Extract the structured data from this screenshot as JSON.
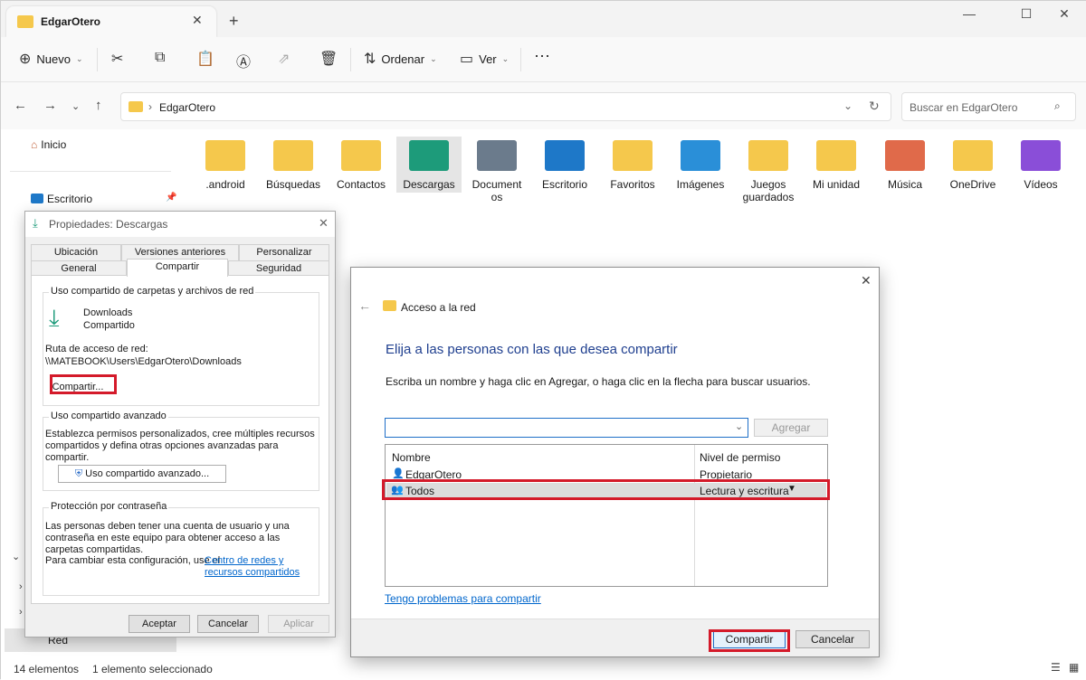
{
  "window": {
    "tab_title": "EdgarOtero",
    "new_tab": "+",
    "close_tab": "✕"
  },
  "toolbar": {
    "new_label": "Nuevo",
    "sort_label": "Ordenar",
    "view_label": "Ver",
    "more": "···"
  },
  "address": {
    "path": "EdgarOtero",
    "search_placeholder": "Buscar en EdgarOtero"
  },
  "sidebar": {
    "home": "Inicio",
    "desktop": "Escritorio",
    "network": "Red"
  },
  "folders": [
    {
      "label": ".android",
      "color": "#f5c84c"
    },
    {
      "label": "Búsquedas",
      "color": "#f5c84c"
    },
    {
      "label": "Contactos",
      "color": "#f5c84c"
    },
    {
      "label": "Descargas",
      "color": "#1d9b7a"
    },
    {
      "label": "Document\nos",
      "color": "#6b7b8c"
    },
    {
      "label": "Escritorio",
      "color": "#1e78c8"
    },
    {
      "label": "Favoritos",
      "color": "#f5c84c"
    },
    {
      "label": "Imágenes",
      "color": "#2a8fd8"
    },
    {
      "label": "Juegos\nguardados",
      "color": "#f5c84c"
    },
    {
      "label": "Mi unidad",
      "color": "#f5c84c"
    },
    {
      "label": "Música",
      "color": "#e06a4a"
    },
    {
      "label": "OneDrive",
      "color": "#f5c84c"
    },
    {
      "label": "Vídeos",
      "color": "#8a4ed8"
    }
  ],
  "status": {
    "count": "14 elementos",
    "selected": "1 elemento seleccionado"
  },
  "props": {
    "title": "Propiedades: Descargas",
    "tabs_top": [
      "Ubicación",
      "Versiones anteriores",
      "Personalizar"
    ],
    "tabs_bottom": [
      "General",
      "Compartir",
      "Seguridad"
    ],
    "group1_title": "Uso compartido de carpetas y archivos de red",
    "folder_name": "Downloads",
    "folder_state": "Compartido",
    "path_label": "Ruta de acceso de red:",
    "path_value": "\\\\MATEBOOK\\Users\\EdgarOtero\\Downloads",
    "share_btn": "Compartir...",
    "group2_title": "Uso compartido avanzado",
    "group2_text": "Establezca permisos personalizados, cree múltiples recursos compartidos y defina otras opciones avanzadas para compartir.",
    "adv_btn": "Uso compartido avanzado...",
    "group3_title": "Protección por contraseña",
    "group3_text": "Las personas deben tener una cuenta de usuario y una contraseña en este equipo para obtener acceso a las carpetas compartidas.",
    "group3_text2": "Para cambiar esta configuración, use el",
    "group3_link": "Centro de redes y recursos compartidos",
    "ok": "Aceptar",
    "cancel": "Cancelar",
    "apply": "Aplicar"
  },
  "share": {
    "title": "Acceso a la red",
    "heading": "Elija a las personas con las que desea compartir",
    "instructions": "Escriba un nombre y haga clic en Agregar, o haga clic en la flecha para buscar usuarios.",
    "add_btn": "Agregar",
    "col_name": "Nombre",
    "col_perm": "Nivel de permiso",
    "rows": [
      {
        "name": "EdgarOtero",
        "perm": "Propietario"
      },
      {
        "name": "Todos",
        "perm": "Lectura y escritura"
      }
    ],
    "help_link": "Tengo problemas para compartir",
    "share_btn": "Compartir",
    "cancel_btn": "Cancelar"
  }
}
